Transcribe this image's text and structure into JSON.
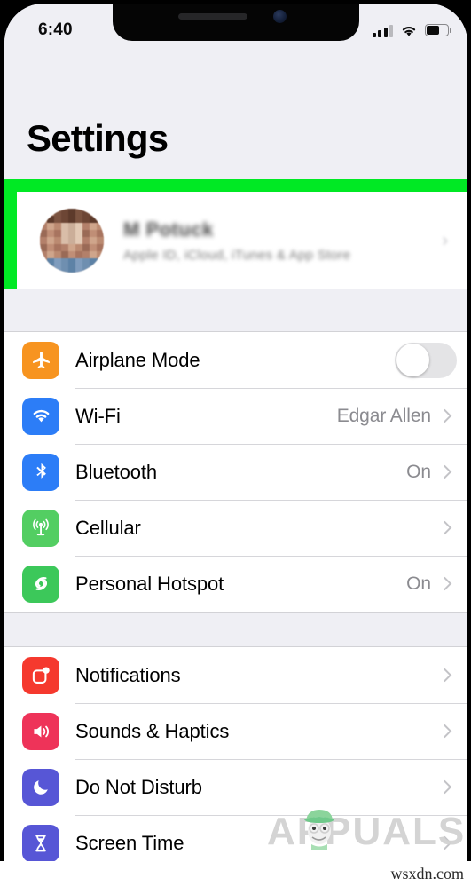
{
  "status_bar": {
    "time": "6:40",
    "signal_icon": "cellular-signal-icon",
    "signal_bars_total": 4,
    "signal_bars_filled": 3,
    "wifi_icon": "wifi-icon",
    "battery_icon": "battery-icon",
    "battery_percent": 60
  },
  "header": {
    "title": "Settings"
  },
  "account": {
    "name": "M Potuck",
    "subtitle": "Apple ID, iCloud, iTunes & App Store",
    "avatar_icon": "avatar",
    "chevron_icon": "chevron-right-icon",
    "highlighted": true,
    "highlight_color": "#00E924"
  },
  "groups": [
    {
      "name": "connectivity",
      "rows": [
        {
          "label": "Airplane Mode",
          "icon": "airplane-icon",
          "icon_color": "#F79420",
          "accessory": "toggle",
          "toggle_on": false,
          "value": ""
        },
        {
          "label": "Wi-Fi",
          "icon": "wifi-icon",
          "icon_color": "#2C7DF7",
          "accessory": "chevron",
          "value": "Edgar Allen"
        },
        {
          "label": "Bluetooth",
          "icon": "bluetooth-icon",
          "icon_color": "#2C7DF7",
          "accessory": "chevron",
          "value": "On"
        },
        {
          "label": "Cellular",
          "icon": "cellular-antenna-icon",
          "icon_color": "#53CE62",
          "accessory": "chevron",
          "value": ""
        },
        {
          "label": "Personal Hotspot",
          "icon": "hotspot-link-icon",
          "icon_color": "#3CC85A",
          "accessory": "chevron",
          "value": "On"
        }
      ]
    },
    {
      "name": "system",
      "rows": [
        {
          "label": "Notifications",
          "icon": "notifications-badge-icon",
          "icon_color": "#F5392E",
          "accessory": "chevron",
          "value": ""
        },
        {
          "label": "Sounds & Haptics",
          "icon": "speaker-waves-icon",
          "icon_color": "#EE3359",
          "accessory": "chevron",
          "value": ""
        },
        {
          "label": "Do Not Disturb",
          "icon": "moon-icon",
          "icon_color": "#5756D6",
          "accessory": "chevron",
          "value": ""
        },
        {
          "label": "Screen Time",
          "icon": "hourglass-icon",
          "icon_color": "#5756D6",
          "accessory": "chevron",
          "value": ""
        }
      ]
    }
  ],
  "watermarks": {
    "appuals": "APPUALS",
    "source": "wsxdn.com"
  }
}
